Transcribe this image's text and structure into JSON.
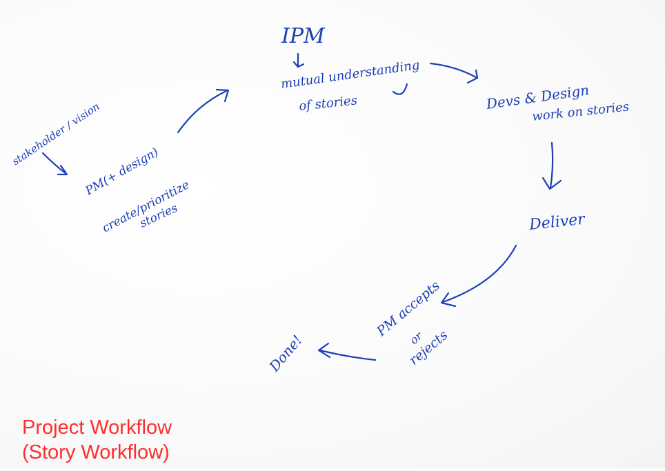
{
  "nodes": {
    "ipm": "IPM",
    "mutual_line1": "mutual understanding",
    "mutual_line2": "of stories",
    "devs_line1": "Devs & Design",
    "devs_line2": "work on stories",
    "deliver": "Deliver",
    "pm_accepts_line1": "PM accepts",
    "pm_accepts_line2": "or",
    "pm_accepts_line3": "rejects",
    "done": "Done!",
    "stakeholder": "stakeholder / vision",
    "pm_design_line1": "PM(+ design)",
    "pm_design_line2": "create/prioritize",
    "pm_design_line3": "stories"
  },
  "caption": {
    "line1": "Project Workflow",
    "line2": "(Story Workflow)"
  },
  "colors": {
    "ink": "#1a3fb5",
    "caption": "#ff2d2d",
    "paper": "#fbfbfb"
  }
}
